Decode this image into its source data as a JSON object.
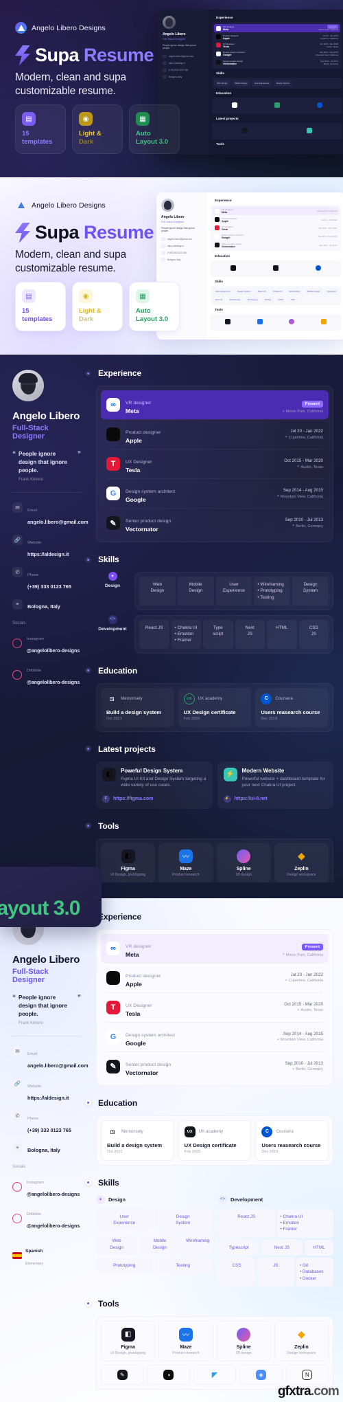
{
  "brand": {
    "name": "Angelo Libero Designs",
    "logo_icon": "triangle-logo-icon"
  },
  "hero": {
    "title_part1": "Supa ",
    "title_part2": "Resume",
    "bolt_icon": "lightning-bolt-icon",
    "subtitle_line1": "Modern, clean and supa",
    "subtitle_line2": "customizable resume.",
    "features": [
      {
        "icon": "layout-grid-icon",
        "line1": "15",
        "line2": "templates",
        "color": "#8e7bff"
      },
      {
        "icon": "lightbulb-icon",
        "line1": "Light &",
        "line2": "Dark",
        "color": "#e8c83a"
      },
      {
        "icon": "auto-layout-icon",
        "line1": "Auto",
        "line2": "Layout 3.0",
        "color": "#3fc57f"
      }
    ]
  },
  "resume": {
    "name": "Angelo Libero",
    "role": "Full-Stack Designer",
    "avatar": "profile-photo",
    "quote": "People ignore design that ignore people.",
    "quote_author": "Frank Kimero",
    "contacts": [
      {
        "icon": "mail-icon",
        "label": "Email",
        "value": "angelo.libero@gmail.com"
      },
      {
        "icon": "link-icon",
        "label": "Website",
        "value": "https://aldesign.it"
      },
      {
        "icon": "phone-icon",
        "label": "Phone",
        "value": "(+39) 333 0123 765"
      },
      {
        "icon": "pin-icon",
        "label": "",
        "value": "Bologna, Italy"
      }
    ],
    "socials_heading": "Socials",
    "socials": [
      {
        "icon": "instagram-icon",
        "label": "Instagram",
        "value": "@angelolibero-designs"
      },
      {
        "icon": "dribbble-icon",
        "label": "Dribbble",
        "value": "@angelolibero-designs"
      }
    ],
    "language": {
      "flag": "spain-flag-icon",
      "name": "Spanish",
      "level": "Elementary"
    },
    "sections": {
      "experience": "Experience",
      "skills": "Skills",
      "education": "Education",
      "projects": "Latest projects",
      "tools": "Tools"
    },
    "experience": [
      {
        "logo": "meta-logo-icon",
        "role": "VR designer",
        "company": "Meta",
        "badge": "Present",
        "date": "",
        "location": "Menlo Park, California",
        "highlight": true
      },
      {
        "logo": "apple-logo-icon",
        "role": "Product designer",
        "company": "Apple",
        "badge": "",
        "date": "Jul 20 - Jan 2022",
        "location": "Cupertino, California",
        "highlight": false
      },
      {
        "logo": "tesla-logo-icon",
        "role": "UX Designer",
        "company": "Tesla",
        "badge": "",
        "date": "Oct 2015 - Mar 2020",
        "location": "Austin, Texas",
        "highlight": false
      },
      {
        "logo": "google-logo-icon",
        "role": "Design system architect",
        "company": "Google",
        "badge": "",
        "date": "Sep 2014 - Aug 2015",
        "location": "Mountain View, California",
        "highlight": false
      },
      {
        "logo": "vectornator-logo-icon",
        "role": "Senior product design",
        "company": "Vectornator",
        "badge": "",
        "date": "Sep 2010 - Jul 2013",
        "location": "Berlin, Germany",
        "highlight": false
      }
    ],
    "skills": [
      {
        "icon": "design-pen-icon",
        "label": "Design",
        "cells": [
          {
            "lines": [
              "Web",
              "Design"
            ],
            "bulleted": false
          },
          {
            "lines": [
              "Mobile",
              "Design"
            ],
            "bulleted": false
          },
          {
            "lines": [
              "User",
              "Experience"
            ],
            "bulleted": false
          },
          {
            "lines": [
              "Wireframing",
              "Prototyping",
              "Testing"
            ],
            "bulleted": true
          },
          {
            "lines": [
              "Design",
              "System"
            ],
            "bulleted": false
          }
        ]
      },
      {
        "icon": "code-brackets-icon",
        "label": "Development",
        "cells": [
          {
            "lines": [
              "React JS"
            ],
            "bulleted": false
          },
          {
            "lines": [
              "Chakra UI",
              "Emotion",
              "Framer"
            ],
            "bulleted": true
          },
          {
            "lines": [
              "Type",
              "script"
            ],
            "bulleted": false
          },
          {
            "lines": [
              "Next",
              "JS"
            ],
            "bulleted": false
          },
          {
            "lines": [
              "HTML"
            ],
            "bulleted": false
          },
          {
            "lines": [
              "CSS",
              "JS"
            ],
            "bulleted": false
          },
          {
            "lines": [
              "Git",
              "Databases",
              "Docker"
            ],
            "bulleted": true
          }
        ]
      }
    ],
    "education": [
      {
        "logo": "memorisely-logo-icon",
        "provider": "Memorisely",
        "title": "Build a design system",
        "date": "Oct 2021"
      },
      {
        "logo": "ux-academy-logo-icon",
        "provider": "UX academy",
        "title": "UX Design certificate",
        "date": "Feb 2020"
      },
      {
        "logo": "coursera-logo-icon",
        "provider": "Coursera",
        "title": "Users reasearch course",
        "date": "Dec 2019"
      }
    ],
    "projects": [
      {
        "logo": "figma-logo-icon",
        "title": "Poweful Design System",
        "desc": "Figma UI Kit and Design System targeting a wide variety of use cases.",
        "link": "https://figma.com",
        "link_icon": "figma-small-icon"
      },
      {
        "logo": "chakra-bolt-icon",
        "title": "Modern Website",
        "desc": "Powerful website + dashboard template for your next Chakra UI project.",
        "link": "https://ui-8.net",
        "link_icon": "chakra-small-icon"
      }
    ],
    "tools": [
      {
        "icon": "figma-tool-icon",
        "name": "Figma",
        "desc": "UI Design, prototyping"
      },
      {
        "icon": "maze-tool-icon",
        "name": "Maze",
        "desc": "Product research"
      },
      {
        "icon": "spline-tool-icon",
        "name": "Spline",
        "desc": "3D design"
      },
      {
        "icon": "zeplin-tool-icon",
        "name": "Zeplin",
        "desc": "Design workspace"
      }
    ],
    "tools_row2": [
      {
        "icon": "vectornator-small-icon"
      },
      {
        "icon": "framer-small-icon"
      },
      {
        "icon": "vscode-small-icon"
      },
      {
        "icon": "sketch-small-icon"
      },
      {
        "icon": "notion-small-icon"
      }
    ]
  },
  "watermark": {
    "text1": "gfxtra",
    "text2": ".com"
  }
}
